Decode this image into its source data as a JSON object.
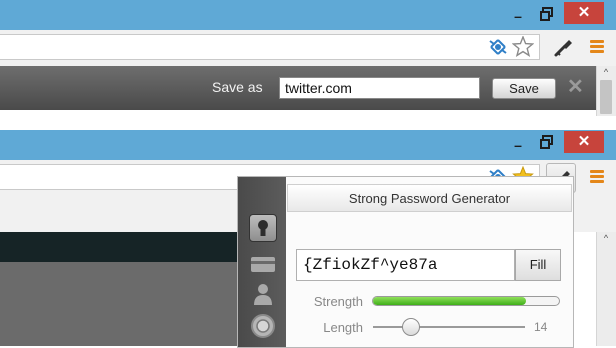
{
  "window_controls": {
    "minimize": "–",
    "close": "✕"
  },
  "icons": {
    "extension": "extension-icon",
    "star_empty": "bookmark-star-icon",
    "star_filled": "bookmark-star-filled-icon",
    "key": "key-icon",
    "menu": "hamburger-menu-icon"
  },
  "save_bar": {
    "label": "Save as",
    "input_value": "twitter.com",
    "save_button": "Save",
    "dismiss": "✕"
  },
  "scroll_arrow": "^",
  "generator": {
    "title": "Strong Password Generator",
    "password": "{ZfiokZf^ye87a",
    "fill_button": "Fill",
    "strength_label": "Strength",
    "strength_fraction": 0.82,
    "length_label": "Length",
    "length_value": "14",
    "length_fraction": 0.25
  },
  "colors": {
    "titlebar": "#5fa9d6",
    "close": "#c7443c",
    "menu": "#e4871a",
    "strength": "#3fae19",
    "star_filled": "#f2c01e"
  }
}
